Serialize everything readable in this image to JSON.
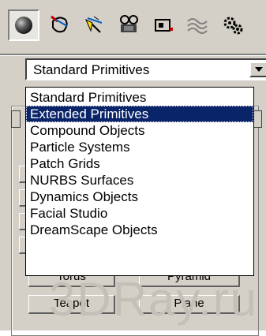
{
  "toolbar": {
    "buttons": [
      {
        "icon": "sphere-icon",
        "active": true
      },
      {
        "icon": "shapes-icon",
        "active": false
      },
      {
        "icon": "lights-icon",
        "active": false
      },
      {
        "icon": "cameras-icon",
        "active": false
      },
      {
        "icon": "helpers-icon",
        "active": false
      },
      {
        "icon": "spacewarps-icon",
        "active": false
      },
      {
        "icon": "systems-icon",
        "active": false
      }
    ]
  },
  "dropdown": {
    "selected": "Standard Primitives"
  },
  "list": {
    "items": [
      "Standard Primitives",
      "Extended Primitives",
      "Compound Objects",
      "Particle Systems",
      "Patch Grids",
      "NURBS Surfaces",
      "Dynamics Objects",
      "Facial Studio",
      "DreamScape Objects"
    ],
    "highlighted_index": 1
  },
  "background_buttons": {
    "torus": "Torus",
    "pyramid": "Pyramid",
    "teapot": "Teapot",
    "plane": "Plane"
  },
  "watermark": "3DRay.ru",
  "colors": {
    "panel": "#d4d0c8",
    "highlight": "#0a246a"
  }
}
